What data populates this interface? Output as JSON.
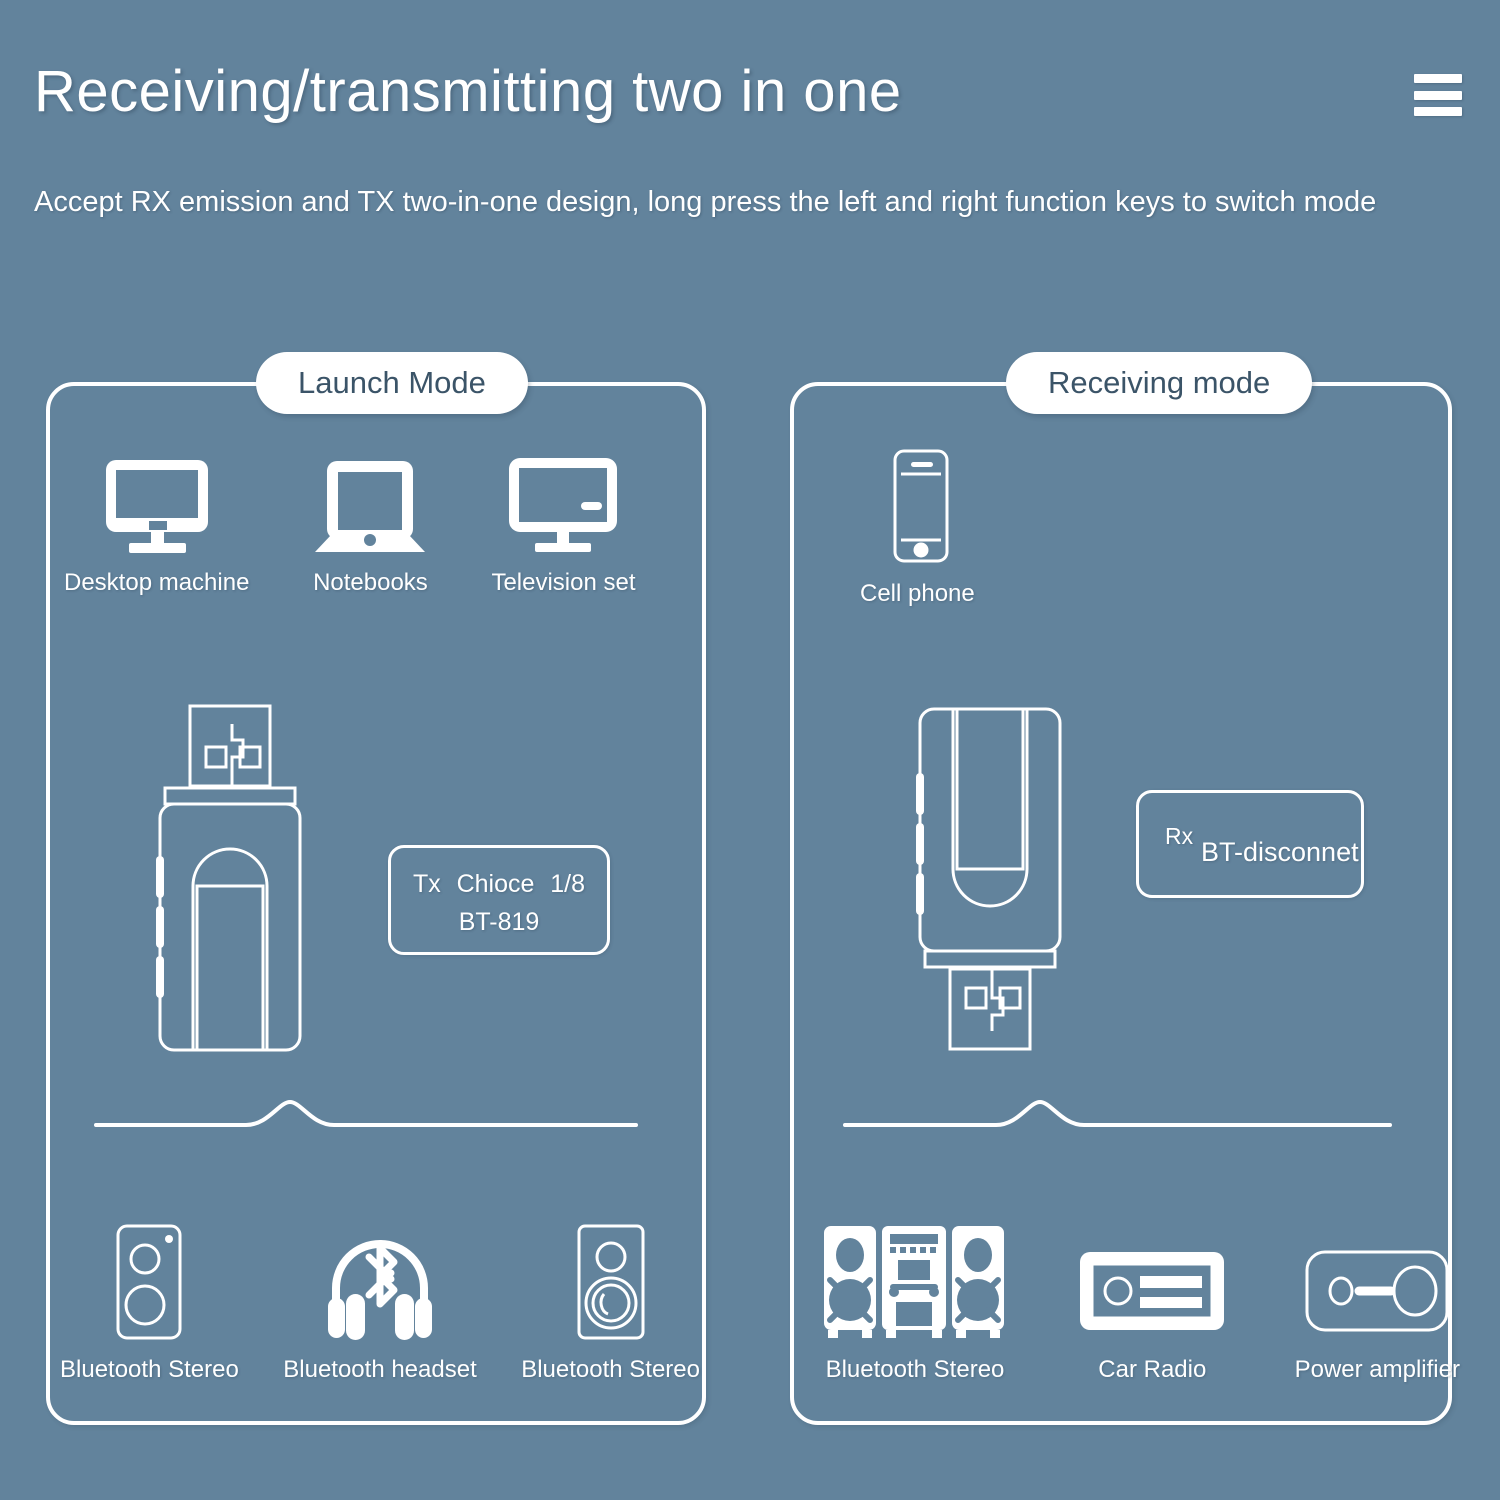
{
  "header": {
    "title": "Receiving/transmitting two in one",
    "subtitle": "Accept RX emission and TX two-in-one design, long press the left and right function keys to switch mode",
    "menu_icon": "hamburger-menu-icon"
  },
  "colors": {
    "background": "#62839c",
    "line": "#ffffff",
    "pill_text": "#3b5468"
  },
  "panels": {
    "left": {
      "title": "Launch Mode",
      "sources": [
        {
          "label": "Desktop machine",
          "icon": "desktop-monitor-icon"
        },
        {
          "label": "Notebooks",
          "icon": "laptop-icon"
        },
        {
          "label": "Television set",
          "icon": "television-icon"
        }
      ],
      "device_screen": {
        "mode": "Tx",
        "menu": "Chioce",
        "index": "1/8",
        "name": "BT-819"
      },
      "outputs": [
        {
          "label": "Bluetooth Stereo",
          "icon": "speaker-box-icon"
        },
        {
          "label": "Bluetooth headset",
          "icon": "bluetooth-headset-icon"
        },
        {
          "label": "Bluetooth Stereo",
          "icon": "studio-speaker-icon"
        }
      ]
    },
    "right": {
      "title": "Receiving mode",
      "sources": [
        {
          "label": "Cell phone",
          "icon": "cell-phone-icon"
        }
      ],
      "device_screen": {
        "mode": "Rx",
        "status": "BT-disconnet"
      },
      "outputs": [
        {
          "label": "Bluetooth Stereo",
          "icon": "hifi-stereo-system-icon"
        },
        {
          "label": "Car Radio",
          "icon": "car-radio-icon"
        },
        {
          "label": "Power amplifier",
          "icon": "power-amplifier-icon"
        }
      ]
    }
  }
}
